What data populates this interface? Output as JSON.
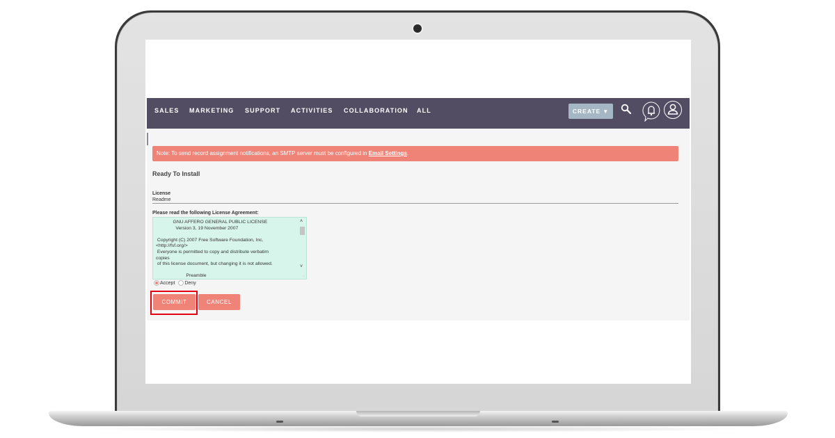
{
  "nav": {
    "items": [
      "SALES",
      "MARKETING",
      "SUPPORT",
      "ACTIVITIES",
      "COLLABORATION",
      "ALL"
    ],
    "create_label": "CREATE",
    "create_caret": "▼",
    "icons": [
      "search-icon",
      "notifications-bell-icon",
      "user-profile-icon"
    ]
  },
  "alert": {
    "text": "Note: To send record assignment notifications, an SMTP server must be configured in ",
    "link_text": "Email Settings",
    "suffix": "."
  },
  "page": {
    "heading": "Ready To Install",
    "tabs": [
      "License",
      "Readme"
    ],
    "license_prompt": "Please read the following License Agreement:",
    "license_text": "             GNU AFFERO GENERAL PUBLIC LICENSE\n               Version 3, 19 November 2007\n\n Copyright (C) 2007 Free Software Foundation, Inc.\n<http://fsf.org/>\n Everyone is permitted to copy and distribute verbatim\ncopies\n of this license document, but changing it is not allowed.\n\n                       Preamble",
    "radio_options": [
      {
        "label": "Accept",
        "checked": true
      },
      {
        "label": "Deny",
        "checked": false
      }
    ],
    "commit_label": "COMMIT",
    "cancel_label": "CANCEL"
  },
  "colors": {
    "navbar": "#534d64",
    "accent": "#f08377",
    "create_button": "#a5b6c4",
    "license_bg": "#d8f5ec",
    "highlight": "#e3000f"
  }
}
